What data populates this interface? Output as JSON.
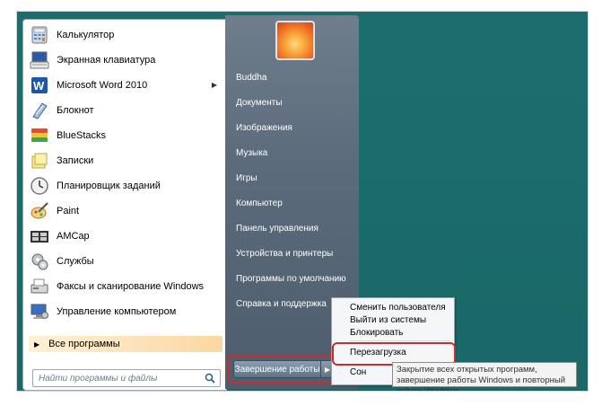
{
  "programs": [
    {
      "label": "Калькулятор",
      "icon": "calculator-icon"
    },
    {
      "label": "Экранная клавиатура",
      "icon": "onscreen-keyboard-icon"
    },
    {
      "label": "Microsoft Word 2010",
      "icon": "word-icon",
      "has_submenu": true,
      "icon_letter": "W"
    },
    {
      "label": "Блокнот",
      "icon": "notepad-icon"
    },
    {
      "label": "BlueStacks",
      "icon": "bluestacks-icon"
    },
    {
      "label": "Записки",
      "icon": "sticky-notes-icon"
    },
    {
      "label": "Планировщик заданий",
      "icon": "task-scheduler-icon"
    },
    {
      "label": "Paint",
      "icon": "paint-icon"
    },
    {
      "label": "AMCap",
      "icon": "amcap-icon"
    },
    {
      "label": "Службы",
      "icon": "services-icon"
    },
    {
      "label": "Факсы и сканирование Windows",
      "icon": "fax-scan-icon"
    },
    {
      "label": "Управление компьютером",
      "icon": "computer-management-icon"
    }
  ],
  "all_programs": "Все программы",
  "search_placeholder": "Найти программы и файлы",
  "right_links": [
    "Buddha",
    "Документы",
    "Изображения",
    "Музыка",
    "Игры",
    "Компьютер",
    "Панель управления",
    "Устройства и принтеры",
    "Программы по умолчанию",
    "Справка и поддержка"
  ],
  "shutdown_label": "Завершение работы",
  "submenu": {
    "items": [
      "Сменить пользователя",
      "Выйти из системы",
      "Блокировать",
      "Перезагрузка",
      "Сон"
    ]
  },
  "tooltip": "Закрытие всех открытых программ, завершение работы Windows и повторный запуск Windows.",
  "colors": {
    "desktop": "#1a6b6a",
    "highlight": "#d12a2a",
    "right_pane": "#5b6b7b"
  }
}
